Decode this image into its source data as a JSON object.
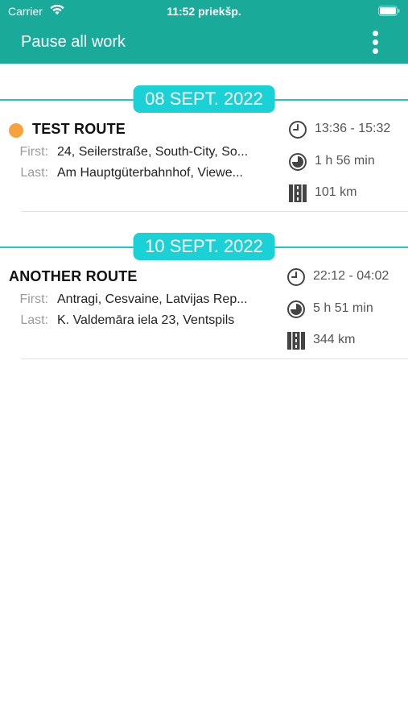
{
  "status_bar": {
    "carrier": "Carrier",
    "time": "11:52 priekšp.",
    "wifi_icon": "wifi-icon",
    "battery_icon": "battery-icon"
  },
  "nav": {
    "title": "Pause all work",
    "menu_icon": "more-vertical-icon"
  },
  "colors": {
    "header_bg": "#19aa99",
    "date_pill_bg": "#1ad1d6",
    "date_line": "#1ec6cc",
    "status_dot": "#f7a23b"
  },
  "sections": [
    {
      "date": "08 SEPT. 2022",
      "routes": [
        {
          "name": "TEST ROUTE",
          "has_status_dot": true,
          "first_label": "First:",
          "first_value": "24, Seilerstraße, South-City, So...",
          "last_label": "Last:",
          "last_value": "Am Hauptgüterbahnhof, Viewe...",
          "time_range": "13:36 - 15:32",
          "duration": "1 h 56 min",
          "distance": "101 km"
        }
      ]
    },
    {
      "date": "10 SEPT. 2022",
      "routes": [
        {
          "name": "ANOTHER ROUTE",
          "has_status_dot": false,
          "first_label": "First:",
          "first_value": "Antragi, Cesvaine, Latvijas Rep...",
          "last_label": "Last:",
          "last_value": "K. Valdemāra iela 23, Ventspils",
          "time_range": "22:12 - 04:02",
          "duration": "5 h 51 min",
          "distance": "344 km"
        }
      ]
    }
  ]
}
